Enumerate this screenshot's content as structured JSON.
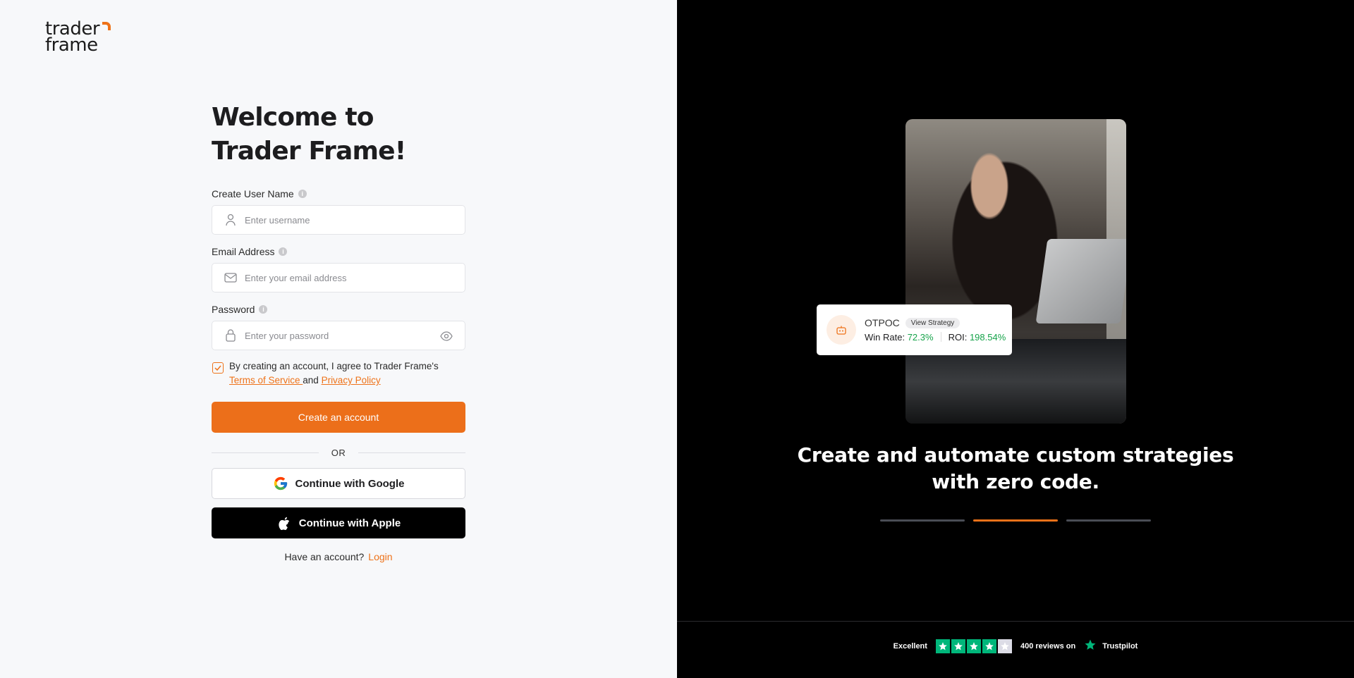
{
  "brand": {
    "logo_line1": "trader",
    "logo_line2": "frame",
    "accent": "#ee7219"
  },
  "form": {
    "title_line1": "Welcome to",
    "title_line2": "Trader Frame!",
    "username": {
      "label": "Create User Name",
      "placeholder": "Enter username"
    },
    "email": {
      "label": "Email Address",
      "placeholder": "Enter your email address"
    },
    "password": {
      "label": "Password",
      "placeholder": "Enter your password"
    },
    "agree": {
      "checked": true,
      "text": "By creating an account, I agree to Trader Frame's",
      "tos": "Terms of Service ",
      "and": " and ",
      "privacy": "Privacy Policy"
    },
    "create_button": "Create an account",
    "or": "OR",
    "google_button": "Continue with Google",
    "apple_button": "Continue with Apple",
    "have_account": "Have an account?",
    "login_link": "Login"
  },
  "promo": {
    "strategy": {
      "name": "OTPOC",
      "view": "View Strategy",
      "win_label": "Win Rate:",
      "win_value": "72.3%",
      "roi_label": "ROI:",
      "roi_value": "198.54%"
    },
    "headline_line1": "Create and automate custom strategies",
    "headline_line2": "with zero code.",
    "carousel_active_index": 1
  },
  "trustpilot": {
    "rating_word": "Excellent",
    "stars": 4,
    "reviews": "400 reviews on",
    "brand": "Trustpilot"
  }
}
